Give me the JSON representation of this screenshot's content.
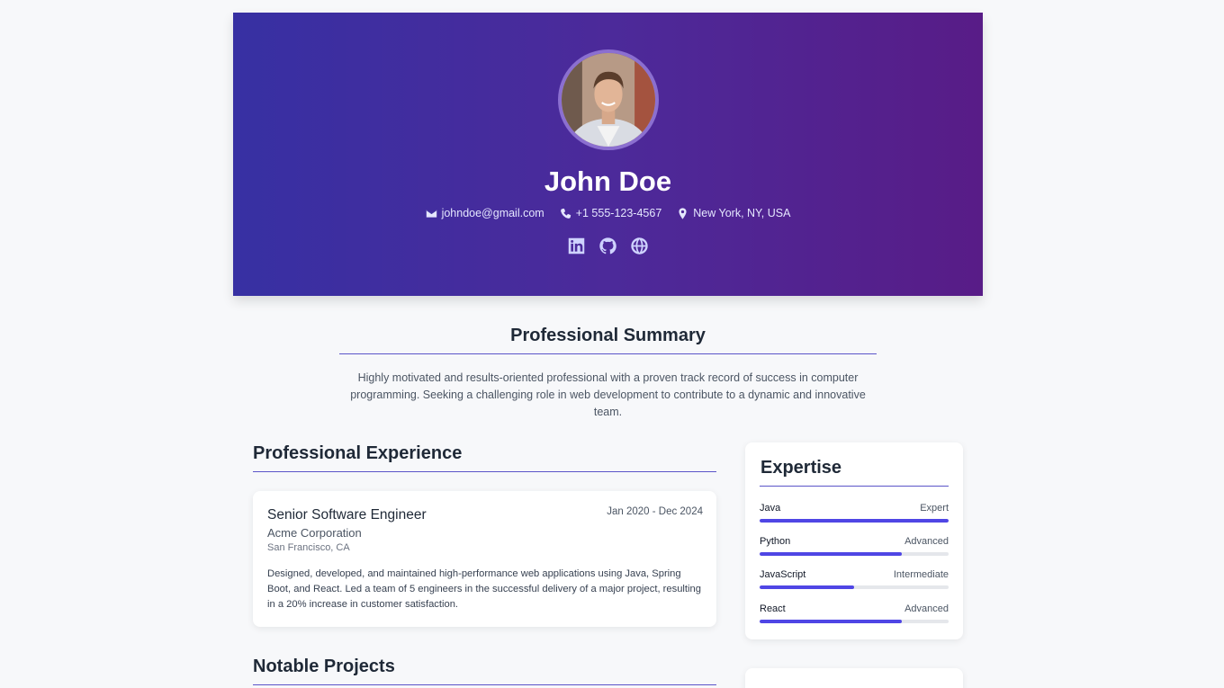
{
  "profile": {
    "name": "John Doe",
    "email": "johndoe@gmail.com",
    "phone": "+1 555-123-4567",
    "location": "New York, NY, USA",
    "socials": [
      "linkedin-icon",
      "github-icon",
      "globe-icon"
    ]
  },
  "summary": {
    "title": "Professional Summary",
    "text": "Highly motivated and results-oriented professional with a proven track record of success in computer programming. Seeking a challenging role in web development to contribute to a dynamic and innovative team."
  },
  "experience": {
    "title": "Professional Experience",
    "jobs": [
      {
        "title": "Senior Software Engineer",
        "dates": "Jan 2020 - Dec 2024",
        "company": "Acme Corporation",
        "location": "San Francisco, CA",
        "description": "Designed, developed, and maintained high-performance web applications using Java, Spring Boot, and React. Led a team of 5 engineers in the successful delivery of a major project, resulting in a 20% increase in customer satisfaction."
      }
    ]
  },
  "projects": {
    "title": "Notable Projects"
  },
  "expertise": {
    "title": "Expertise",
    "skills": [
      {
        "name": "Java",
        "level": "Expert",
        "fraction": 1.0
      },
      {
        "name": "Python",
        "level": "Advanced",
        "fraction": 0.75
      },
      {
        "name": "JavaScript",
        "level": "Intermediate",
        "fraction": 0.5
      },
      {
        "name": "React",
        "level": "Advanced",
        "fraction": 0.75
      }
    ]
  },
  "colors": {
    "accent": "#4f46e5",
    "hero_start": "#3730a3",
    "hero_end": "#581c87"
  }
}
